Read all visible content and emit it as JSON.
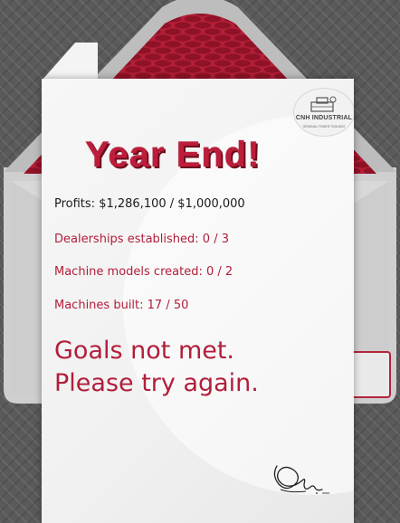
{
  "logo": {
    "name": "CNH INDUSTRIAL",
    "tagline": "ORIGINAL TOWER TOOLBOX"
  },
  "letter": {
    "title": "Year End!",
    "profits": "Profits: $1,286,100 / $1,000,000",
    "dealerships": "Dealerships established: 0 / 3",
    "models": "Machine models created: 0 / 2",
    "built": "Machines built: 17 / 50",
    "result_line1": "Goals not met.",
    "result_line2": "Please try again."
  },
  "icons": [
    "logo-icon",
    "signature-icon",
    "envelope-icon"
  ],
  "colors": {
    "accent_red": "#b21e3a",
    "envelope_grey": "#c9c9c9",
    "background": "#5a5a5a"
  }
}
